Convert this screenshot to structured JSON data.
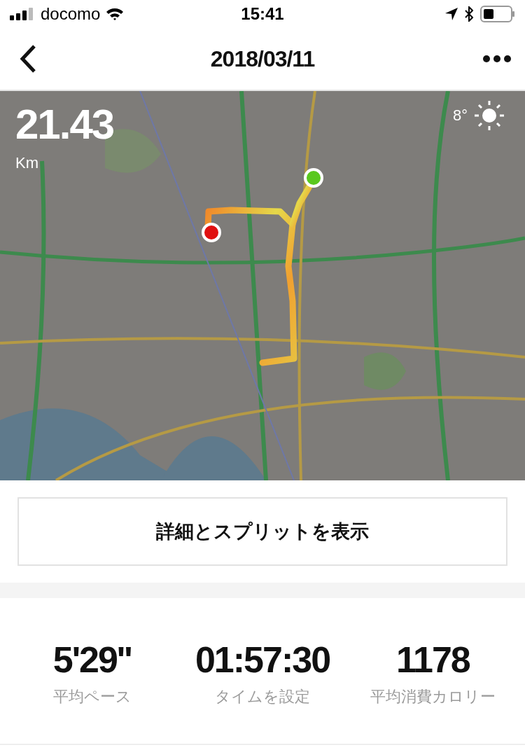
{
  "status_bar": {
    "carrier": "docomo",
    "time": "15:41"
  },
  "nav": {
    "title": "2018/03/11"
  },
  "map": {
    "distance": "21.43",
    "unit": "Km",
    "temperature": "8°"
  },
  "details_button": {
    "label": "詳細とスプリットを表示"
  },
  "stats": [
    {
      "value": "5'29''",
      "label": "平均ペース"
    },
    {
      "value": "01:57:30",
      "label": "タイムを設定"
    },
    {
      "value": "1178",
      "label": "平均消費カロリー"
    }
  ]
}
